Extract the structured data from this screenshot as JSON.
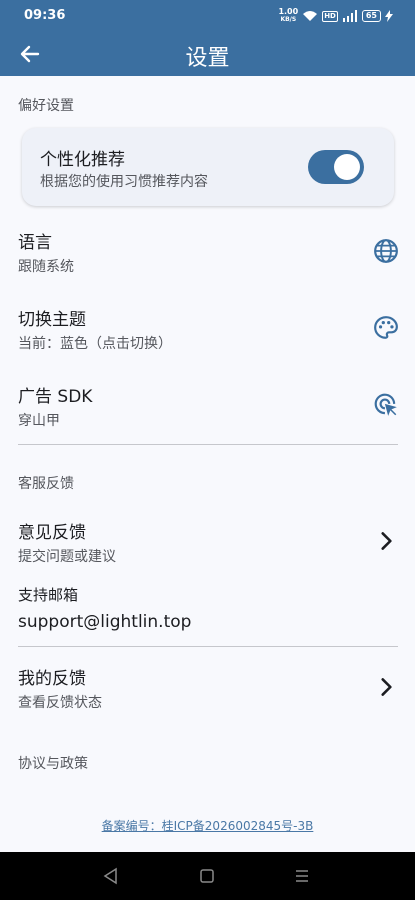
{
  "status": {
    "time": "09:36",
    "net_speed": "1.00",
    "net_unit": "KB/S",
    "hd": "HD",
    "battery": "65"
  },
  "appbar": {
    "title": "设置"
  },
  "sections": {
    "prefs": "偏好设置",
    "service": "客服反馈",
    "policy": "协议与政策"
  },
  "personalize": {
    "title": "个性化推荐",
    "subtitle": "根据您的使用习惯推荐内容",
    "enabled": true
  },
  "language": {
    "title": "语言",
    "subtitle": "跟随系统"
  },
  "theme": {
    "title": "切换主题",
    "subtitle": "当前：蓝色（点击切换）"
  },
  "ads": {
    "title": "广告 SDK",
    "subtitle": "穿山甲"
  },
  "feedback": {
    "title": "意见反馈",
    "subtitle": "提交问题或建议"
  },
  "support": {
    "label": "支持邮箱",
    "email": "support@lightlin.top"
  },
  "my_feedback": {
    "title": "我的反馈",
    "subtitle": "查看反馈状态"
  },
  "footer": {
    "icp": "备案编号：桂ICP备2026002845号-3B"
  },
  "colors": {
    "primary": "#3b6fa0",
    "background": "#f8f9fd",
    "link": "#4a78a6"
  }
}
